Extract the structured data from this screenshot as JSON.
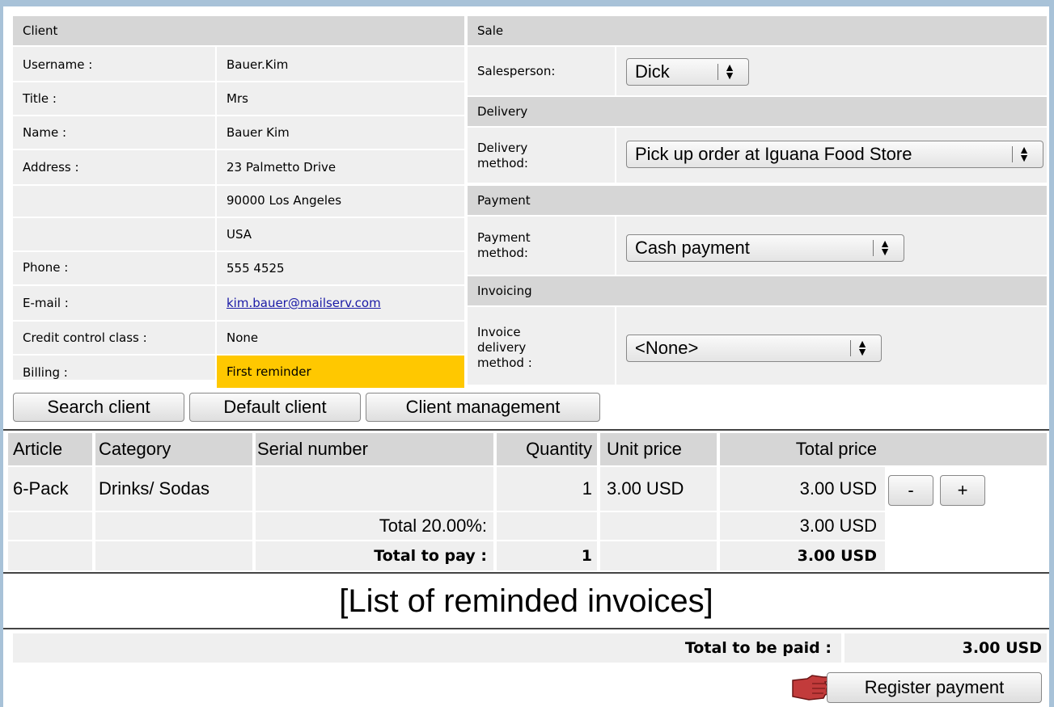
{
  "client": {
    "header": "Client",
    "rows": [
      {
        "label": "Username :",
        "value": "Bauer.Kim"
      },
      {
        "label": "Title :",
        "value": "Mrs"
      },
      {
        "label": "Name :",
        "value": "Bauer Kim"
      },
      {
        "label": "Address :",
        "value": "23 Palmetto Drive"
      },
      {
        "label": "",
        "value": "90000 Los Angeles"
      },
      {
        "label": "",
        "value": "USA"
      },
      {
        "label": "Phone :",
        "value": "555 4525"
      },
      {
        "label": "E-mail :",
        "value": "kim.bauer@mailserv.com"
      },
      {
        "label": "Credit control class :",
        "value": "None"
      },
      {
        "label": "Billing :",
        "value": "First reminder"
      }
    ],
    "billing_highlight_color": "#ffc800"
  },
  "sale": {
    "header": "Sale",
    "salesperson_label": "Salesperson:",
    "salesperson_value": "Dick",
    "delivery_header": "Delivery",
    "delivery_label_1": "Delivery",
    "delivery_label_2": "method:",
    "delivery_value": "Pick up order at Iguana Food Store",
    "payment_header": "Payment",
    "payment_label_1": "Payment",
    "payment_label_2": "method:",
    "payment_value": "Cash payment",
    "invoicing_header": "Invoicing",
    "invoice_label_1": "Invoice",
    "invoice_label_2": "delivery",
    "invoice_label_3": "method :",
    "invoice_value": "<None>"
  },
  "buttons": {
    "search_client": "Search client",
    "default_client": "Default client",
    "client_management": "Client management"
  },
  "cart": {
    "columns": [
      "Article",
      "Category",
      "Serial number",
      "Quantity",
      "Unit price",
      "Total price"
    ],
    "item": {
      "article": "6-Pack",
      "category": "Drinks/ Sodas",
      "serial": "",
      "quantity": "1",
      "unit_price": "3.00 USD",
      "total_price": "3.00 USD"
    },
    "minus": "-",
    "plus": "+",
    "tax_label": "Total 20.00%:",
    "tax_value": "3.00 USD",
    "total_label": "Total to pay :",
    "total_quantity": "1",
    "total_value": "3.00 USD"
  },
  "reminded": {
    "title": "[List of reminded invoices]"
  },
  "footer": {
    "total_label": "Total to be paid :",
    "total_value": "3.00 USD",
    "register_button": "Register payment",
    "pointer_icon": "pointing-hand-icon"
  }
}
